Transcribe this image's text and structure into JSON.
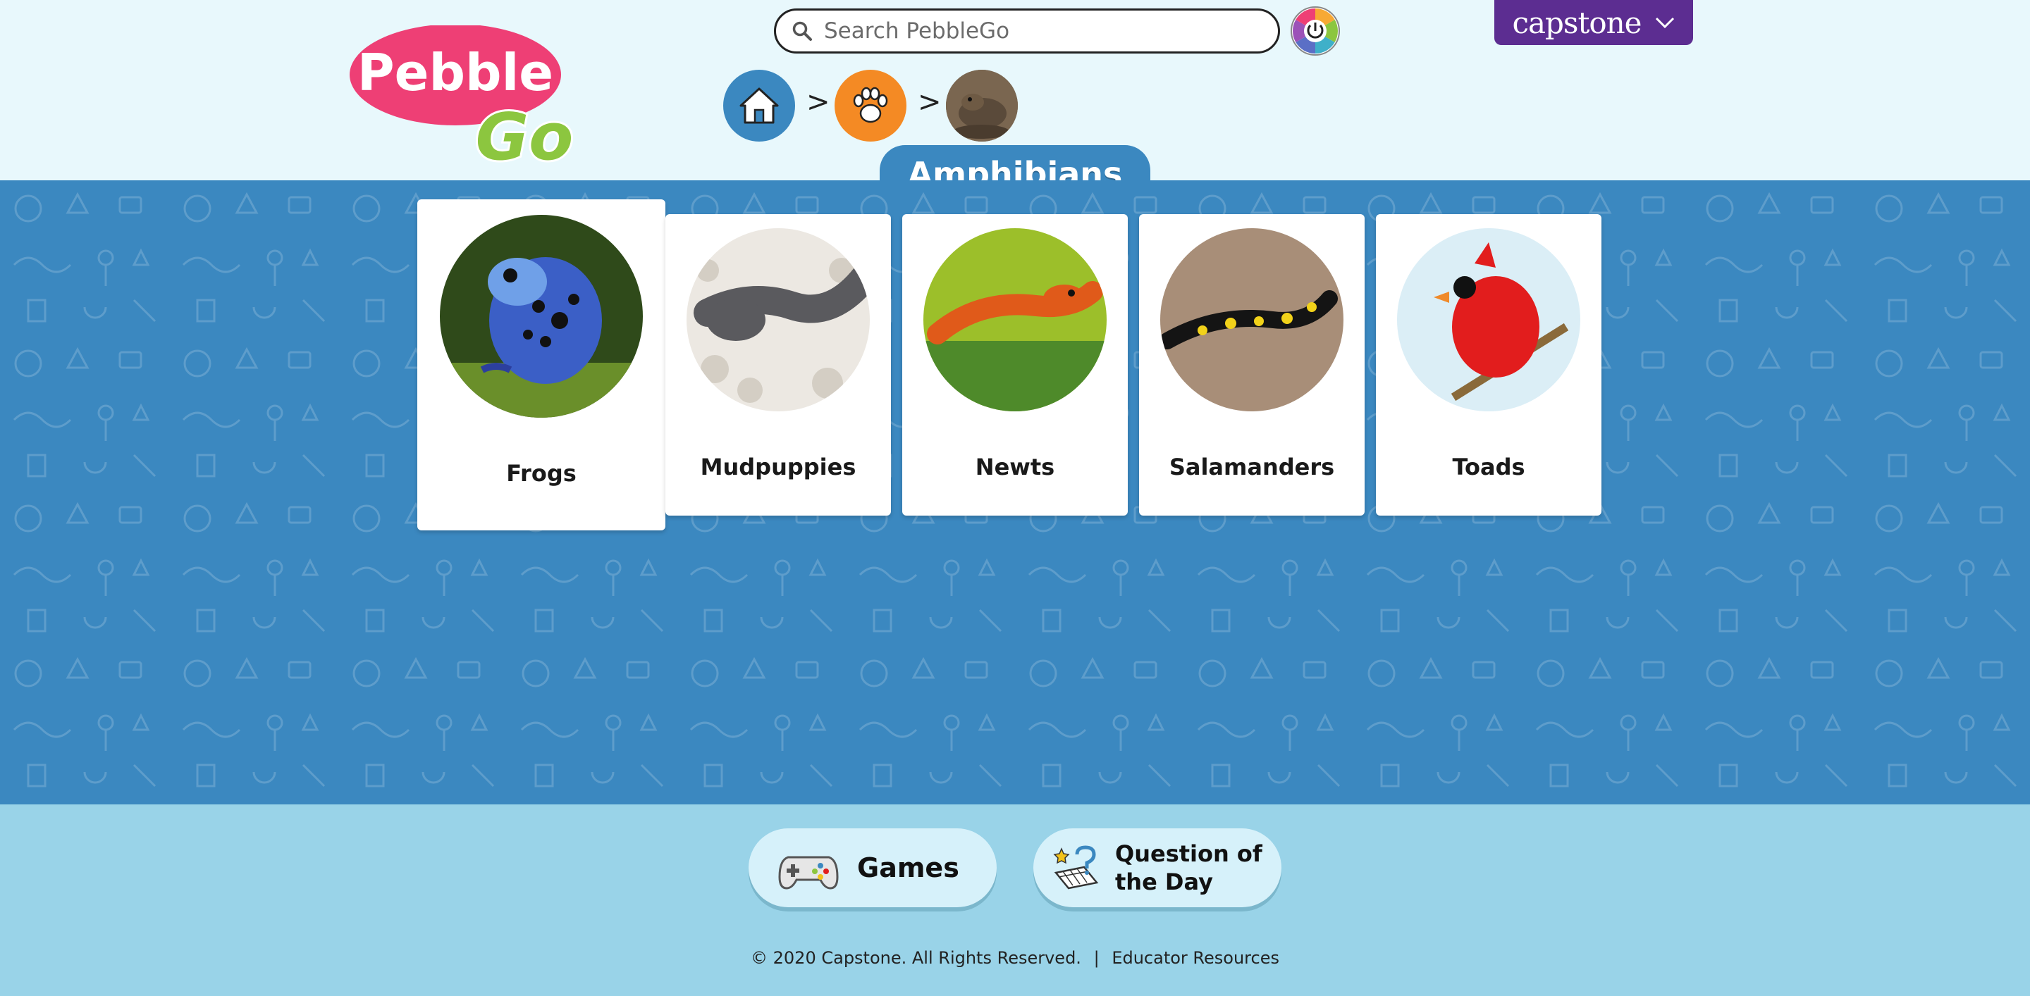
{
  "header": {
    "logo": {
      "line1": "Pebble",
      "line2": "Go",
      "pebble_color": "#ee3f75",
      "go_color": "#8cc63f"
    },
    "search": {
      "placeholder": "Search PebbleGo",
      "value": ""
    },
    "contrast_icon": "color-wheel-icon",
    "capstone": {
      "label": "capstone",
      "color": "#5c2d91"
    }
  },
  "breadcrumb": {
    "items": [
      {
        "name": "home",
        "icon": "home-icon",
        "color": "#3b88c0"
      },
      {
        "name": "animals",
        "icon": "paw-icon",
        "color": "#f48a24"
      },
      {
        "name": "amphibians",
        "icon": "toad-thumbnail"
      }
    ],
    "separator": ">"
  },
  "page": {
    "title": "Amphibians",
    "accent": "#3b88c0"
  },
  "categories": [
    {
      "label": "Frogs",
      "image": "blue-poison-dart-frog",
      "selected": true
    },
    {
      "label": "Mudpuppies",
      "image": "mudpuppy"
    },
    {
      "label": "Newts",
      "image": "orange-newt"
    },
    {
      "label": "Salamanders",
      "image": "fire-salamander"
    },
    {
      "label": "Toads",
      "image": "red-cardinal"
    }
  ],
  "footer": {
    "games": {
      "label": "Games",
      "icon": "game-controller-icon"
    },
    "qotd": {
      "line1": "Question of",
      "line2": "the Day",
      "icon": "question-calendar-icon"
    },
    "copyright": "© 2020 Capstone. All Rights Reserved.",
    "separator": "|",
    "educator_link": "Educator Resources"
  }
}
